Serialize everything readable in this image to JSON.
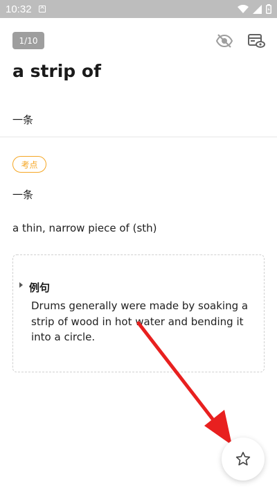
{
  "status_bar": {
    "time": "10:32"
  },
  "card": {
    "counter": "1/10",
    "word": "a strip of",
    "meaning": "一条",
    "exam_badge": "考点",
    "exam_meaning": "一条",
    "definition": "a thin, narrow piece of (sth)",
    "example": {
      "label": "例句",
      "sentence": "Drums generally were made by soaking a strip of wood in hot water and bending it into a circle."
    }
  },
  "icons": {
    "hide": "eye-off-icon",
    "preview": "card-preview-icon",
    "favorite": "star-outline-icon"
  },
  "colors": {
    "accent": "#f5a623",
    "annotation": "#e8201f",
    "status_bar": "#bdbdbd"
  }
}
